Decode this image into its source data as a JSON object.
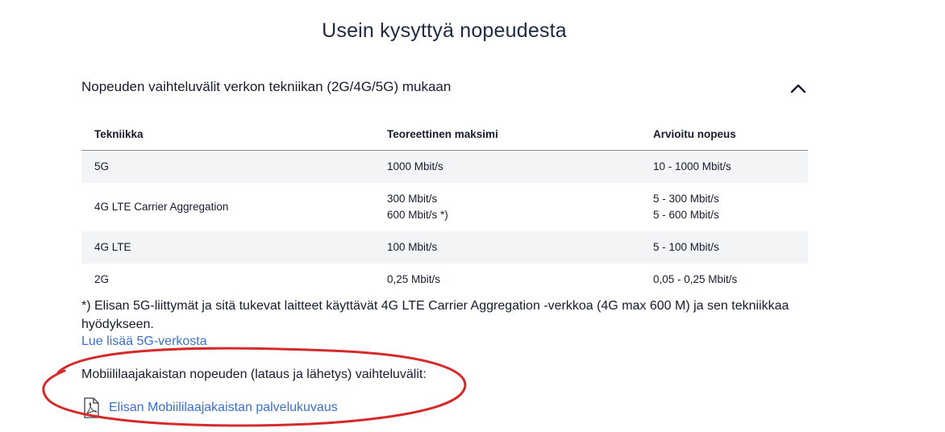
{
  "page": {
    "title": "Usein kysyttyä nopeudesta"
  },
  "accordion": {
    "title": "Nopeuden vaihteluvälit verkon tekniikan (2G/4G/5G) mukaan",
    "toggle_icon": "chevron-up-icon"
  },
  "table": {
    "headers": [
      "Tekniikka",
      "Teoreettinen maksimi",
      "Arvioitu nopeus"
    ],
    "rows": [
      {
        "tech": "5G",
        "max": [
          "1000 Mbit/s"
        ],
        "est": [
          "10 - 1000 Mbit/s"
        ]
      },
      {
        "tech": "4G LTE Carrier Aggregation",
        "max": [
          "300 Mbit/s",
          "600 Mbit/s *)"
        ],
        "est": [
          "5 - 300 Mbit/s",
          "5 - 600 Mbit/s"
        ]
      },
      {
        "tech": "4G LTE",
        "max": [
          "100 Mbit/s"
        ],
        "est": [
          "5 - 100 Mbit/s"
        ]
      },
      {
        "tech": "2G",
        "max": [
          "0,25 Mbit/s"
        ],
        "est": [
          "0,05 - 0,25 Mbit/s"
        ]
      }
    ]
  },
  "footnote": "*) Elisan 5G-liittymät ja sitä tukevat laitteet käyttävät 4G LTE Carrier Aggregation -verkkoa (4G max 600 M) ja sen tekniikkaa hyödykseen.",
  "link_5g": "Lue lisää 5G-verkosta",
  "mobile_section": {
    "text": "Mobiililaajakaistan nopeuden (lataus ja lähetys) vaihteluvälit:",
    "pdf_link": "Elisan Mobiililaajakaistan palvelukuvaus",
    "pdf_icon": "pdf-file-icon"
  },
  "colors": {
    "link": "#3b6fd0",
    "text": "#161c2d",
    "row_shade": "#f3f4f6",
    "annotation": "#d42a2a"
  }
}
